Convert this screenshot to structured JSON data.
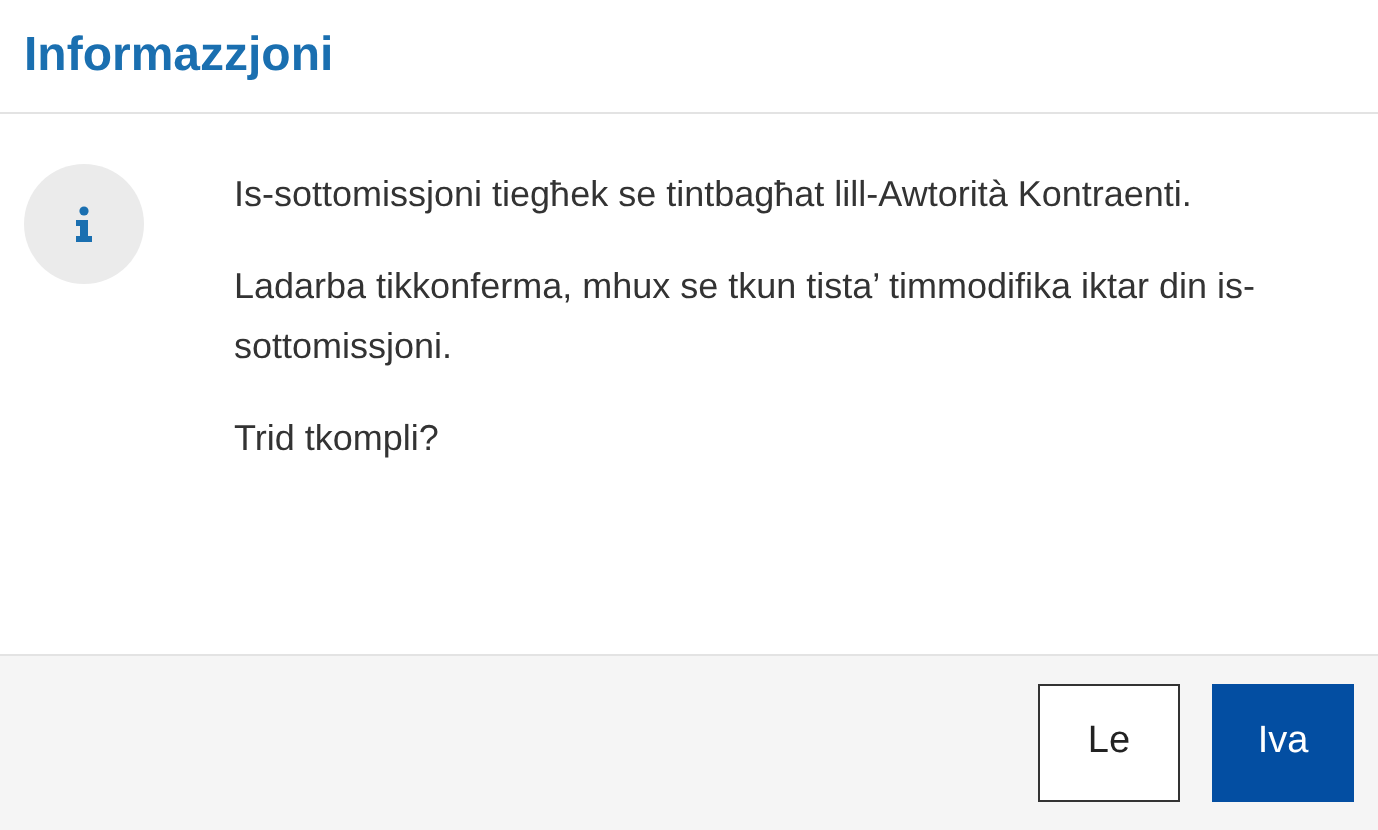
{
  "dialog": {
    "title": "Informazzjoni",
    "paragraphs": [
      "Is-sottomissjoni tiegħek se tintbagħat lill-Awtorità Kontraenti.",
      "Ladarba tikkonferma, mhux se tkun tista’ timmodifika iktar din is-sottomissjoni.",
      "Trid tkompli?"
    ],
    "buttons": [
      {
        "label": "Le",
        "kind": "secondary"
      },
      {
        "label": "Iva",
        "kind": "primary"
      }
    ]
  }
}
